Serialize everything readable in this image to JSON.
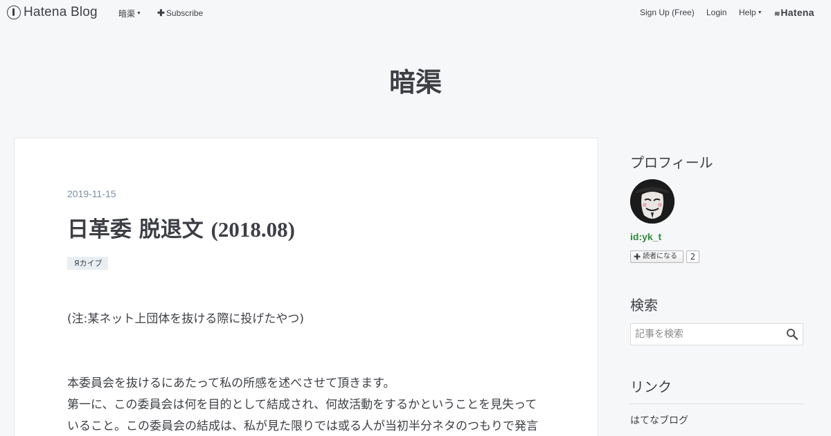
{
  "header": {
    "logo_text": "Hatena Blog",
    "blog_menu_label": "暗渠",
    "subscribe_label": "Subscribe",
    "signup_label": "Sign Up (Free)",
    "login_label": "Login",
    "help_label": "Help",
    "hatena_label": "Hatena"
  },
  "blog": {
    "title": "暗渠"
  },
  "entry": {
    "date": "2019-11-15",
    "title_ja": "日革委 脱退文 ",
    "title_paren": "(2018.08)",
    "category": "Яカイブ",
    "paragraphs": [
      "(注:某ネット上団体を抜ける際に投げたやつ)",
      "本委員会を抜けるにあたって私の所感を述べさせて頂きます。",
      "第一に、この委員会は何を目的として結成され、何故活動をするかということを見失って",
      "いること。この委員会の結成は、私が見た限りでは或る人が当初半分ネタのつもりで発言"
    ]
  },
  "sidebar": {
    "profile_title": "プロフィール",
    "profile_id": "id:yk_t",
    "subscribe_button": "読者になる",
    "subscriber_count": "2",
    "search_title": "検索",
    "search_placeholder": "記事を検索",
    "links_title": "リンク",
    "links": [
      "はてなブログ"
    ]
  },
  "colors": {
    "background": "#f6f7f8",
    "text": "#3d3f44",
    "date": "#7b8ca3",
    "profile_id": "#2e8b3a",
    "category_bg": "#e9eef2"
  }
}
